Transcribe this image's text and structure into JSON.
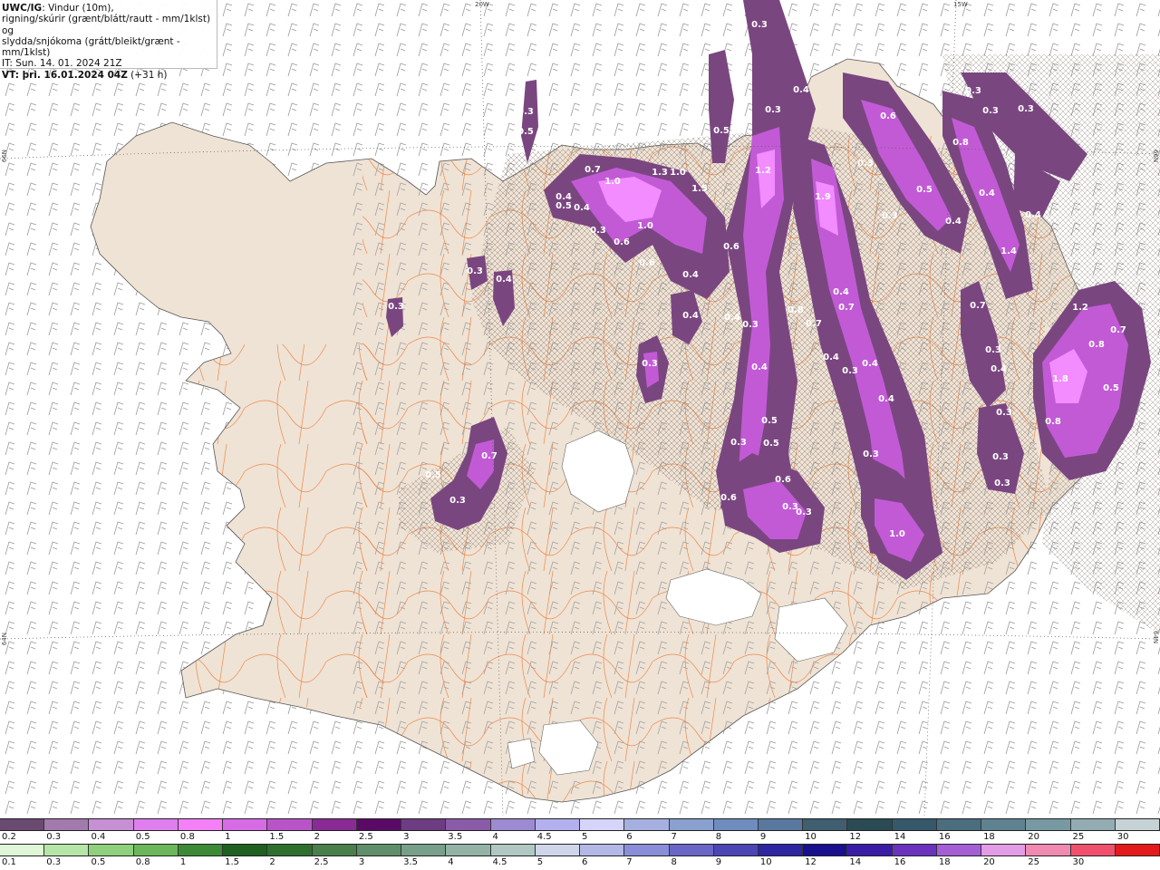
{
  "title": {
    "product": "UWC/IG",
    "line1_rest": ": Vindur (10m),",
    "line2": "rigning/skúrir (grænt/blátt/rautt - mm/1klst) og",
    "line3": "slydda/snjókoma (grátt/bleikt/grænt - mm/1klst)",
    "init_label": "IT: Sun. 14. 01. 2024 21Z",
    "valid_label": "VT: þri. 16.01.2024 04Z",
    "lead": "(+31 h)"
  },
  "graticule": {
    "top_left": "20W",
    "top_right": "15W",
    "left_upper": "66N",
    "left_lower": "64N",
    "right_upper": "66N",
    "right_lower": "64N"
  },
  "colors": {
    "land": "#efe3d5",
    "sea": "#ffffff",
    "roads": "#ee7733",
    "snow_light": "#f28cff",
    "snow_mid": "#c25ad6",
    "snow_dark": "#7a4680",
    "snow_edge": "#5b3c62"
  },
  "precip_values": [
    "0.3",
    "0.7",
    "1.0",
    "1.3",
    "1.0",
    "1.5",
    "1.2",
    "1.9",
    "0.4",
    "0.3",
    "0.5",
    "0.6",
    "0.8",
    "1.4",
    "0.3",
    "0.5",
    "0.4",
    "0.3",
    "0.6",
    "1.0",
    "0.6",
    "0.3",
    "0.4",
    "0.4",
    "0.6",
    "0.3",
    "0.4",
    "0.3",
    "0.4",
    "0.8",
    "0.4",
    "0.3",
    "0.4",
    "0.7",
    "0.4",
    "0.7",
    "0.7",
    "0.4",
    "0.3",
    "0.4",
    "0.4",
    "0.4",
    "0.3",
    "0.4",
    "0.4",
    "0.3",
    "0.3",
    "0.5",
    "0.5",
    "0.3",
    "0.3",
    "0.7",
    "0.5",
    "0.3",
    "0.6",
    "0.6",
    "0.3",
    "0.3",
    "1.0",
    "0.3",
    "0.3",
    "1.8",
    "1.2",
    "0.8",
    "0.5",
    "0.8",
    "0.3",
    "0.3",
    "0.3",
    "0.7",
    "0.4",
    "0.3",
    "0.5",
    "0.5"
  ],
  "colorbar_snow": {
    "ticks": [
      "0.2",
      "0.3",
      "0.4",
      "0.5",
      "0.8",
      "1",
      "1.5",
      "2",
      "2.5",
      "3",
      "3.5",
      "4",
      "4.5",
      "5",
      "6",
      "7",
      "8",
      "9",
      "10",
      "12",
      "14",
      "16",
      "18",
      "20",
      "25",
      "30"
    ],
    "colors": [
      "#6b4a72",
      "#a27aad",
      "#c78fd4",
      "#e07ef0",
      "#f47ff7",
      "#d76be6",
      "#b954c8",
      "#8a2a94",
      "#5a0a66",
      "#6e3c82",
      "#8b5aa8",
      "#9c8ad2",
      "#b4b0f0",
      "#d6d4fa",
      "#a6b0e0",
      "#8aa0d0",
      "#6f8cbf",
      "#59789f",
      "#3f5e70",
      "#2a4a54",
      "#35586a",
      "#4a6e7e",
      "#5f8290",
      "#7799a3",
      "#93acb4",
      "#c6d3d6"
    ]
  },
  "colorbar_rain": {
    "ticks": [
      "0.1",
      "0.3",
      "0.5",
      "0.8",
      "1",
      "1.5",
      "2",
      "2.5",
      "3",
      "3.5",
      "4",
      "4.5",
      "5",
      "6",
      "7",
      "8",
      "9",
      "10",
      "12",
      "14",
      "16",
      "18",
      "20",
      "25",
      "30"
    ],
    "colors": [
      "#dff7d6",
      "#b5e6a7",
      "#8fd07c",
      "#6bb75a",
      "#3d8a36",
      "#1f5f1f",
      "#2e6f2e",
      "#497f4a",
      "#5e8f6a",
      "#789f8a",
      "#93b3a6",
      "#b0c8c2",
      "#cfd6ea",
      "#b3b8e6",
      "#8a8ed8",
      "#6a66c8",
      "#4b45b6",
      "#2e25a3",
      "#18108f",
      "#3a1ca6",
      "#6a32bf",
      "#a45fd6",
      "#e39ce6",
      "#f08ab0",
      "#f0506e",
      "#e41a1a"
    ]
  }
}
